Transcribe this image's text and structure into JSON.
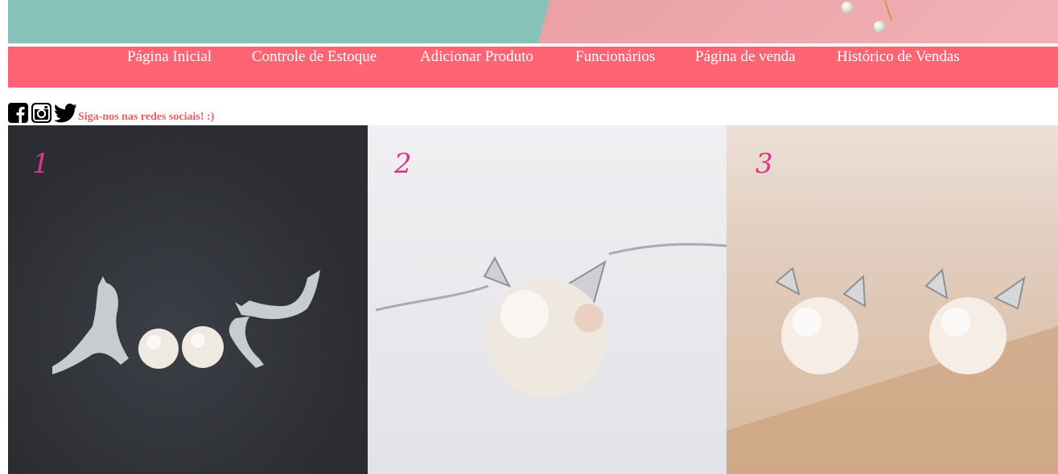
{
  "nav": {
    "items": [
      {
        "label": "Página Inicial"
      },
      {
        "label": "Controle de Estoque"
      },
      {
        "label": "Adicionar Produto"
      },
      {
        "label": "Funcionários"
      },
      {
        "label": "Página de venda"
      },
      {
        "label": "Histórico de Vendas"
      }
    ]
  },
  "social": {
    "icons": [
      "facebook-icon",
      "instagram-icon",
      "twitter-icon"
    ],
    "text": "Siga-nos nas redes sociais! :)"
  },
  "gallery": {
    "panels": [
      {
        "number": "1",
        "subject": "cat earrings with pearls"
      },
      {
        "number": "2",
        "subject": "cat pearl pendant necklace"
      },
      {
        "number": "3",
        "subject": "cat ear pearl earrings"
      }
    ]
  },
  "colors": {
    "nav_background": "#ff6475",
    "nav_text": "#ffffff",
    "social_text": "#ee5a66",
    "banner_teal": "#86c2b9",
    "banner_pink": "#f0aab0",
    "panel_number": "#d7358e"
  }
}
